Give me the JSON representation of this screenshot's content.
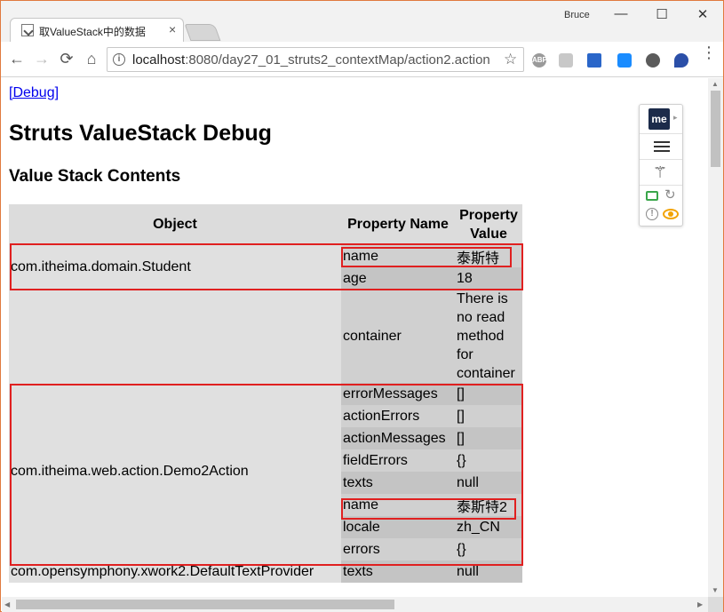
{
  "browser": {
    "tab_title": "取ValueStack中的数据",
    "tab_close": "×",
    "user_name": "Bruce",
    "window_buttons": {
      "minimize": "—",
      "maximize": "☐",
      "close": "✕"
    },
    "nav": {
      "back": "←",
      "forward": "→",
      "reload": "⟳",
      "home": "⌂"
    },
    "url_host": "localhost",
    "url_rest": ":8080/day27_01_struts2_contextMap/action2.action",
    "star": "☆",
    "extensions": [
      "abp-icon",
      "grid-icon",
      "cap-icon",
      "blue-arrow-icon",
      "evernote-icon",
      "vpn-icon"
    ],
    "ext_labels": {
      "abp": "ABP"
    }
  },
  "page": {
    "debug_link": "[Debug]",
    "title": "Struts ValueStack Debug",
    "section_title": "Value Stack Contents",
    "table": {
      "headers": {
        "object": "Object",
        "property_name": "Property Name",
        "property_value_1": "Property",
        "property_value_2": "Value"
      },
      "groups": [
        {
          "object": "com.itheima.domain.Student",
          "rows": [
            {
              "name": "name",
              "value": "泰斯特"
            },
            {
              "name": "age",
              "value": "18"
            },
            {
              "name": "container",
              "value_lines": [
                "There is",
                "no read",
                "method",
                "for",
                "container"
              ]
            }
          ]
        },
        {
          "object": "com.itheima.web.action.Demo2Action",
          "rows": [
            {
              "name": "errorMessages",
              "value": "[]"
            },
            {
              "name": "actionErrors",
              "value": "[]"
            },
            {
              "name": "actionMessages",
              "value": "[]"
            },
            {
              "name": "fieldErrors",
              "value": "{}"
            },
            {
              "name": "texts",
              "value": "null"
            },
            {
              "name": "name",
              "value": "泰斯特2"
            },
            {
              "name": "locale",
              "value": "zh_CN"
            },
            {
              "name": "errors",
              "value": "{}"
            }
          ]
        },
        {
          "object": "com.opensymphony.xwork2.DefaultTextProvider",
          "rows": [
            {
              "name": "texts",
              "value": "null"
            }
          ]
        }
      ]
    }
  },
  "ext_panel": {
    "logo": "me",
    "arrow": "▸",
    "wand": "⚚",
    "refresh": "↻",
    "alert": "!"
  },
  "colors": {
    "highlight_border": "#e02020",
    "link": "#0000ee",
    "window_border": "#e07a3f"
  }
}
